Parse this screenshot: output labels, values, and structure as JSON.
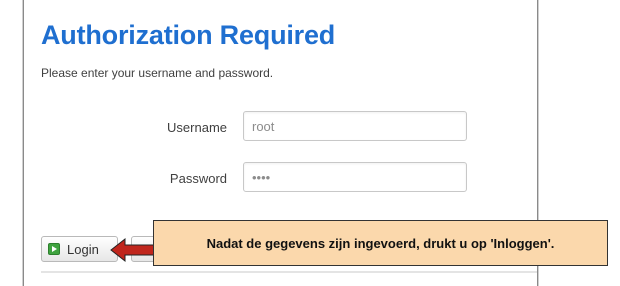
{
  "auth": {
    "title": "Authorization Required",
    "subtitle": "Please enter your username and password."
  },
  "form": {
    "username_label": "Username",
    "username_value": "root",
    "password_label": "Password",
    "password_value": "••••"
  },
  "actions": {
    "login_label": "Login"
  },
  "annotation": {
    "text": "Nadat de gegevens zijn ingevoerd, drukt u op 'Inloggen'."
  },
  "colors": {
    "title": "#1f6fd0",
    "callout_bg": "#fbd8ac",
    "arrow": "#c0261d",
    "login_icon": "#3fa33f"
  },
  "icons": {
    "login": "login-icon",
    "arrow": "arrow-left-icon"
  }
}
